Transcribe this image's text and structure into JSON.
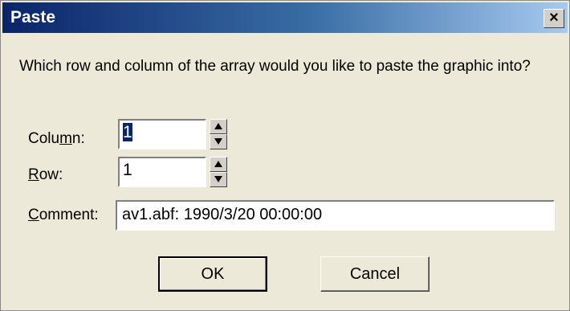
{
  "window": {
    "title": "Paste",
    "close_glyph": "×"
  },
  "prompt": "Which row and column of the array would you like to paste the graphic into?",
  "column": {
    "label_pre": "Colu",
    "label_accel": "m",
    "label_post": "n:",
    "value": "1"
  },
  "row": {
    "label_accel": "R",
    "label_post": "ow:",
    "value": "1"
  },
  "comment": {
    "label_accel": "C",
    "label_post": "omment:",
    "value": "av1.abf: 1990/3/20 00:00:00"
  },
  "buttons": {
    "ok": "OK",
    "cancel": "Cancel"
  },
  "icons": {
    "close": "close-icon",
    "spin_up": "spin-up-icon",
    "spin_down": "spin-down-icon"
  },
  "colors": {
    "titlebar_start": "#0a246a",
    "titlebar_end": "#a6caf0",
    "dialog_bg": "#ece9d8",
    "selection": "#0a246a"
  }
}
